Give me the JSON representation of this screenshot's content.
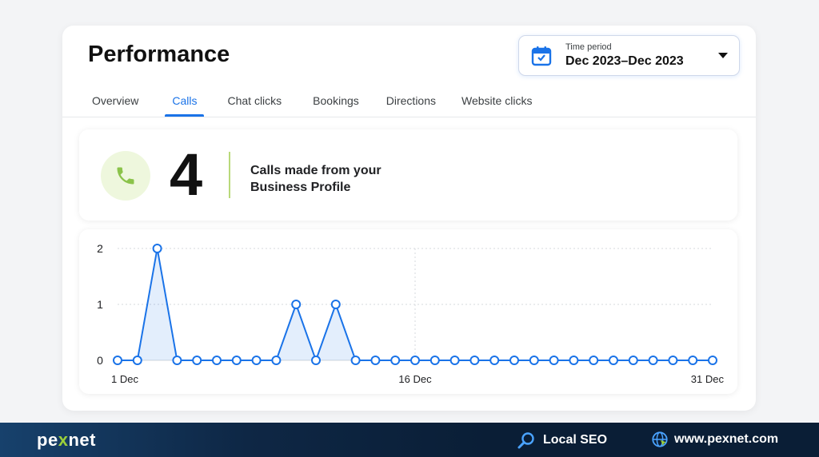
{
  "header": {
    "title": "Performance"
  },
  "time_period": {
    "label": "Time period",
    "value": "Dec 2023–Dec 2023"
  },
  "tabs": [
    {
      "label": "Overview",
      "active": false
    },
    {
      "label": "Calls",
      "active": true
    },
    {
      "label": "Chat clicks",
      "active": false
    },
    {
      "label": "Bookings",
      "active": false
    },
    {
      "label": "Directions",
      "active": false
    },
    {
      "label": "Website clicks",
      "active": false
    }
  ],
  "stat": {
    "value": "4",
    "line1": "Calls made from your",
    "line2": "Business Profile"
  },
  "colors": {
    "accent": "#1a73e8",
    "phone": "#8bc34a",
    "footer": "#0a1e36"
  },
  "chart_data": {
    "type": "line",
    "x_tick_labels": [
      "1 Dec",
      "16 Dec",
      "31 Dec"
    ],
    "y_tick_labels": [
      "0",
      "1",
      "2"
    ],
    "x": [
      1,
      2,
      3,
      4,
      5,
      6,
      7,
      8,
      9,
      10,
      11,
      12,
      13,
      14,
      15,
      16,
      17,
      18,
      19,
      20,
      21,
      22,
      23,
      24,
      25,
      26,
      27,
      28,
      29,
      30,
      31
    ],
    "values": [
      0,
      0,
      2,
      0,
      0,
      0,
      0,
      0,
      0,
      1,
      0,
      1,
      0,
      0,
      0,
      0,
      0,
      0,
      0,
      0,
      0,
      0,
      0,
      0,
      0,
      0,
      0,
      0,
      0,
      0,
      0
    ],
    "ylim": [
      0,
      2
    ],
    "grid": true
  },
  "footer": {
    "brand_pre": "pe",
    "brand_x": "x",
    "brand_post": "net",
    "local_seo": "Local SEO",
    "website": "www.pexnet.com"
  }
}
